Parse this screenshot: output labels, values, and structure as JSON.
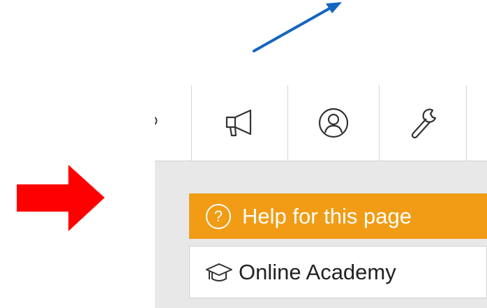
{
  "toolbar": {
    "buttons": [
      {
        "icon": "megaphone-icon"
      },
      {
        "icon": "user-circle-icon"
      },
      {
        "icon": "wrench-icon"
      }
    ]
  },
  "help": {
    "label": "Help for this page",
    "icon": "question-circle-icon"
  },
  "academy": {
    "label": "Online Academy",
    "icon": "graduation-cap-icon"
  },
  "annotations": {
    "red_arrow_color": "#ff0000",
    "blue_arrow_color": "#1565c0"
  },
  "colors": {
    "help_bar": "#f19c14",
    "panel_bg": "#e8e8e8"
  }
}
